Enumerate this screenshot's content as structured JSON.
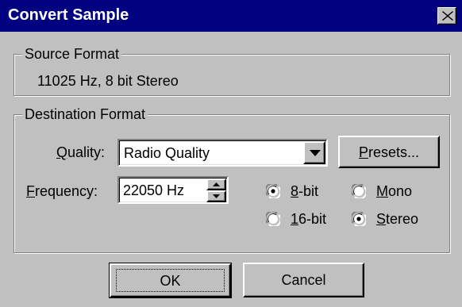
{
  "window": {
    "title": "Convert Sample"
  },
  "source_group": {
    "label": "Source Format",
    "value": "11025 Hz, 8 bit Stereo"
  },
  "destination_group": {
    "label": "Destination Format",
    "quality": {
      "label_mnemonic": "Q",
      "label_rest": "uality:",
      "value": "Radio Quality"
    },
    "frequency": {
      "label_mnemonic": "F",
      "label_rest": "requency:",
      "value": "22050 Hz"
    },
    "presets": {
      "mnemonic": "P",
      "rest": "resets..."
    },
    "bits": [
      {
        "mnemonic": "8",
        "rest": "-bit",
        "selected": true
      },
      {
        "mnemonic": "1",
        "rest": "6-bit",
        "selected": false
      }
    ],
    "channels": [
      {
        "mnemonic": "M",
        "rest": "ono",
        "selected": false
      },
      {
        "mnemonic": "S",
        "rest": "tereo",
        "selected": true
      }
    ]
  },
  "buttons": {
    "ok": "OK",
    "cancel": "Cancel"
  }
}
